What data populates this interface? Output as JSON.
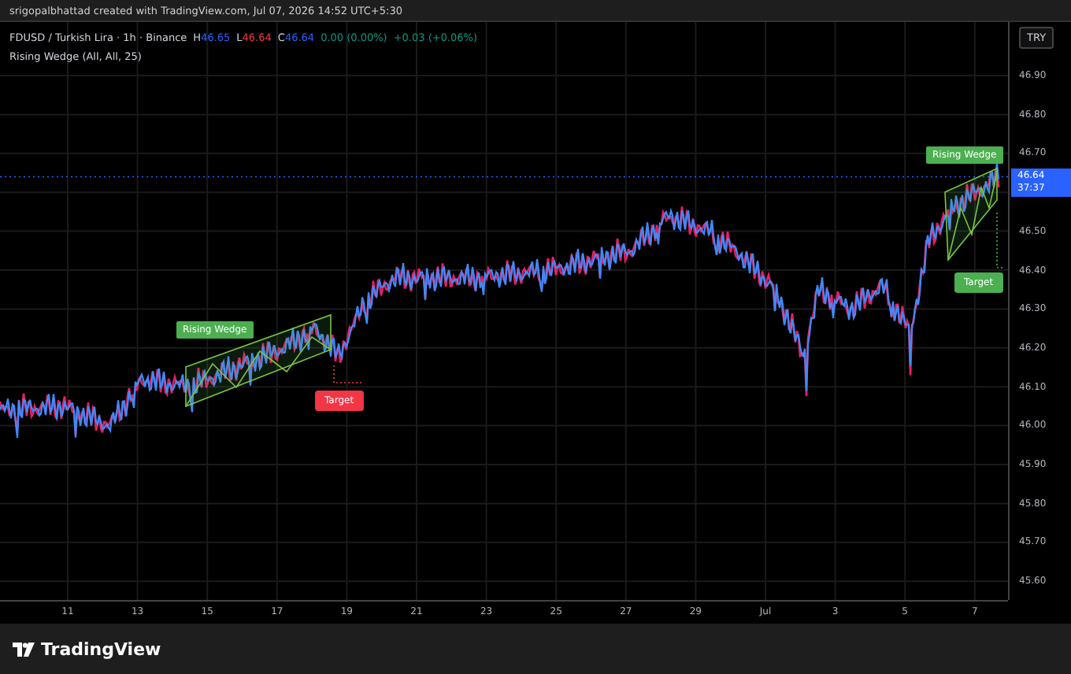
{
  "header": {
    "attribution": "srigopalbhattad created with TradingView.com, Jul 07, 2026 14:52 UTC+5:30"
  },
  "legend": {
    "symbol": "FDUSD / Turkish Lira · 1h · Binance",
    "ohlc": [
      {
        "label": "H",
        "value": "46.65",
        "color": "#2962ff"
      },
      {
        "label": "L",
        "value": "46.64",
        "color": "#f23645"
      },
      {
        "label": "C",
        "value": "46.64",
        "color": "#2962ff"
      }
    ],
    "changes": [
      {
        "text": "0.00 (0.00%)",
        "color": "#089981"
      },
      {
        "text": "+0.03 (+0.06%)",
        "color": "#089981"
      }
    ],
    "indicator": "Rising Wedge (All, All, 25)"
  },
  "currency_button": "TRY",
  "price_axis": {
    "labels": [
      "46.90",
      "46.80",
      "46.70",
      "46.50",
      "46.40",
      "46.30",
      "46.20",
      "46.10",
      "46.00",
      "45.90",
      "45.80",
      "45.70",
      "45.60"
    ],
    "current": {
      "price": "46.64",
      "countdown": "37:37"
    }
  },
  "time_axis": {
    "labels": [
      "11",
      "13",
      "15",
      "17",
      "19",
      "21",
      "23",
      "25",
      "27",
      "29",
      "Jul",
      "3",
      "5",
      "7"
    ]
  },
  "annotations": [
    {
      "kind": "pattern",
      "text": "Rising Wedge",
      "color": "#4caf50"
    },
    {
      "kind": "target",
      "text": "Target",
      "color": "#f23645"
    },
    {
      "kind": "pattern",
      "text": "Rising Wedge",
      "color": "#4caf50"
    },
    {
      "kind": "target",
      "text": "Target",
      "color": "#4caf50"
    }
  ],
  "footer": {
    "logo": "TradingView"
  }
}
